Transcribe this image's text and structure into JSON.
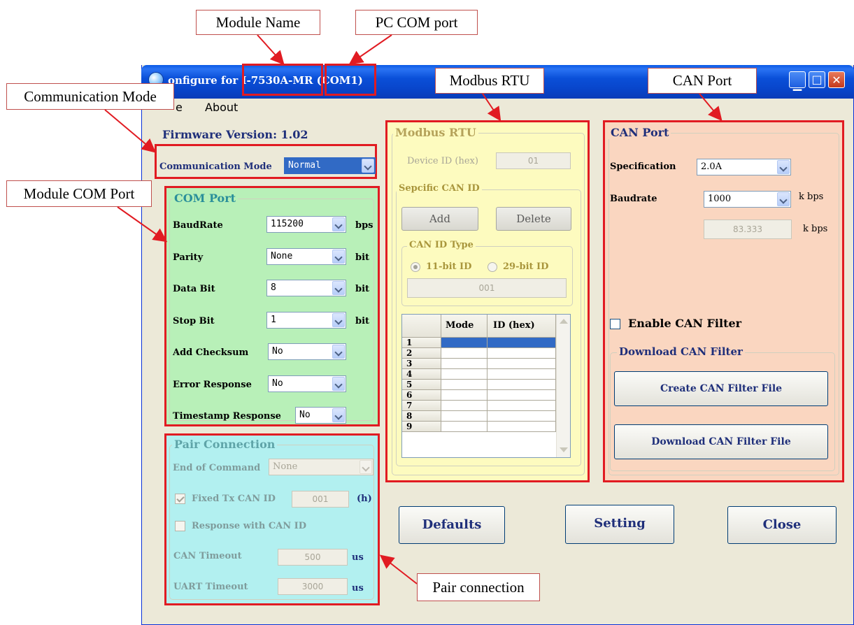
{
  "window": {
    "title_prefix": "onfigure for",
    "module_name": "I-7530A-MR",
    "com_port": "(COM1)"
  },
  "menu": {
    "items": [
      "e",
      "About"
    ]
  },
  "firmware_version": "Firmware Version: 1.02",
  "communication_mode": {
    "label": "Communication Mode",
    "value": "Normal"
  },
  "com_port": {
    "title": "COM Port",
    "rows": [
      {
        "label": "BaudRate",
        "value": "115200",
        "unit": "bps"
      },
      {
        "label": "Parity",
        "value": "None",
        "unit": "bit"
      },
      {
        "label": "Data Bit",
        "value": "8",
        "unit": "bit"
      },
      {
        "label": "Stop Bit",
        "value": "1",
        "unit": "bit"
      },
      {
        "label": "Add Checksum",
        "value": "No",
        "unit": ""
      },
      {
        "label": "Error Response",
        "value": "No",
        "unit": ""
      },
      {
        "label": "Timestamp Response",
        "value": "No",
        "unit": ""
      }
    ]
  },
  "pair_connection": {
    "title": "Pair Connection",
    "end_of_command_label": "End of Command",
    "end_of_command_value": "None",
    "fixed_tx_label": "Fixed Tx CAN ID",
    "fixed_tx_value": "001",
    "fixed_tx_unit": "(h)",
    "fixed_tx_checked": true,
    "response_label": "Response with CAN ID",
    "response_checked": false,
    "can_timeout_label": "CAN Timeout",
    "can_timeout_value": "500",
    "can_timeout_unit": "us",
    "uart_timeout_label": "UART Timeout",
    "uart_timeout_value": "3000",
    "uart_timeout_unit": "us"
  },
  "modbus_rtu": {
    "title": "Modbus RTU",
    "device_id_label": "Device ID (hex)",
    "device_id_value": "01",
    "specific_title": "Sepcific CAN ID",
    "add_label": "Add",
    "delete_label": "Delete",
    "id_type_title": "CAN ID Type",
    "id_11_label": "11-bit ID",
    "id_29_label": "29-bit ID",
    "id_value": "001",
    "grid": {
      "headers": [
        "Mode",
        "ID (hex)"
      ],
      "rows": [
        "1",
        "2",
        "3",
        "4",
        "5",
        "6",
        "7",
        "8",
        "9"
      ]
    }
  },
  "can_port": {
    "title": "CAN Port",
    "spec_label": "Specification",
    "spec_value": "2.0A",
    "baud_label": "Baudrate",
    "baud_value": "1000",
    "baud_unit": "k bps",
    "custom_baud_value": "83.333",
    "custom_baud_unit": "k bps",
    "enable_filter_label": "Enable CAN Filter",
    "enable_filter_checked": false,
    "download_title": "Download CAN Filter",
    "create_filter_label": "Create CAN Filter File",
    "download_filter_label": "Download CAN Filter File"
  },
  "buttons": {
    "defaults": "Defaults",
    "setting": "Setting",
    "close": "Close"
  },
  "callouts": {
    "module_name": "Module Name",
    "pc_com_port": "PC COM port",
    "communication_mode": "Communication Mode",
    "module_com_port": "Module COM Port",
    "modbus_rtu": "Modbus RTU",
    "can_port": "CAN Port",
    "pair_connection": "Pair connection"
  },
  "colors": {
    "annotation_red": "#e11b22",
    "com_panel": "#b8f0b8",
    "pair_panel": "#b2f0f0",
    "rtu_panel": "#fdfbbf",
    "can_panel": "#fad6c0",
    "title_blue": "#1f2f7a",
    "group_title_teal": "#2a8f9a",
    "group_title_olive": "#a9963c",
    "grid_selection": "#316ac5"
  }
}
